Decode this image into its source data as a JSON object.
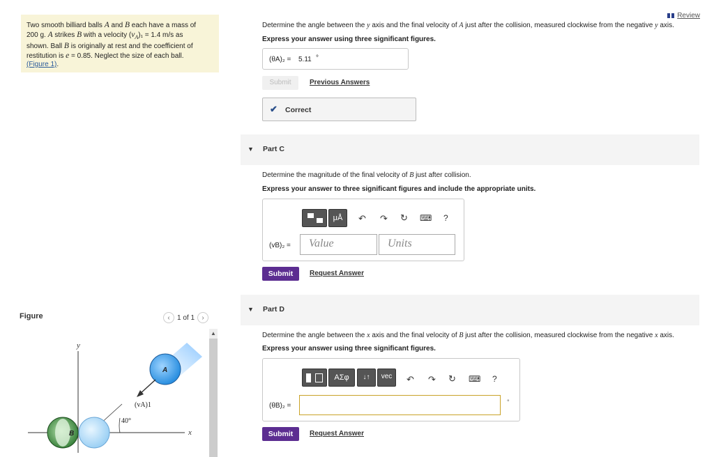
{
  "problem": {
    "t1": "Two smooth billiard balls ",
    "a1": "A",
    "t2": " and ",
    "b1": "B",
    "t3": " each have a mass of",
    "t4": "200 g. ",
    "a2": "A",
    "t5": " strikes ",
    "b2": "B",
    "t6": " with a velocity (",
    "va": "v",
    "vsub": "A",
    "t7": ")₁ = 1.4  m/s as",
    "t8": "shown. Ball ",
    "b3": "B",
    "t9": " is originally at rest and the coefficient of",
    "t10": "restitution is ",
    "e": "e",
    "t11": " = 0.85. Neglect the size of each ball.",
    "fig_link": "(Figure 1)",
    "t12": "."
  },
  "figure": {
    "heading": "Figure",
    "pager_text": "1 of 1",
    "label_y": "y",
    "label_x": "x",
    "label_A": "A",
    "label_B": "B",
    "label_va": "(vA)1",
    "label_angle": "40°",
    "color_ball_A": "#3aa0e8",
    "color_ball_B": "#2f8a3a"
  },
  "review": {
    "label": "Review"
  },
  "partB": {
    "question_pre": "Determine the angle between the ",
    "question_var1": "y",
    "question_mid": " axis and the final velocity of ",
    "question_var2": "A",
    "question_post": " just after the collision, measured clockwise from the negative ",
    "question_var3": "y",
    "question_end": " axis.",
    "instruction": "Express your answer using three significant figures.",
    "answer_label": "(θA)₂ =",
    "answer_value": "5.11",
    "answer_unit": "°",
    "submit_label": "Submit",
    "prev_answers": "Previous Answers",
    "correct_label": "Correct"
  },
  "partC": {
    "title": "Part C",
    "question_pre": "Determine the magnitude of the final velocity of ",
    "question_var": "B",
    "question_post": " just after collision.",
    "instruction": "Express your answer to three significant figures and include the appropriate units.",
    "toolbar_mu": "μÅ",
    "help": "?",
    "answer_label": "(vB)₂ =",
    "value_placeholder": "Value",
    "units_placeholder": "Units",
    "submit_label": "Submit",
    "request_answer": "Request Answer"
  },
  "partD": {
    "title": "Part D",
    "question_pre": "Determine the angle between the ",
    "question_var1": "x",
    "question_mid": " axis and the final velocity of ",
    "question_var2": "B",
    "question_post": " just after the collision, measured clockwise from the negative ",
    "question_var3": "x",
    "question_end": " axis.",
    "instruction": "Express your answer using three significant figures.",
    "toolbar_greek": "ΑΣφ",
    "toolbar_arrows": "↓↑",
    "toolbar_vec": "vec",
    "help": "?",
    "answer_label": "(θB)₂ =",
    "answer_unit": "°",
    "submit_label": "Submit",
    "request_answer": "Request Answer"
  }
}
